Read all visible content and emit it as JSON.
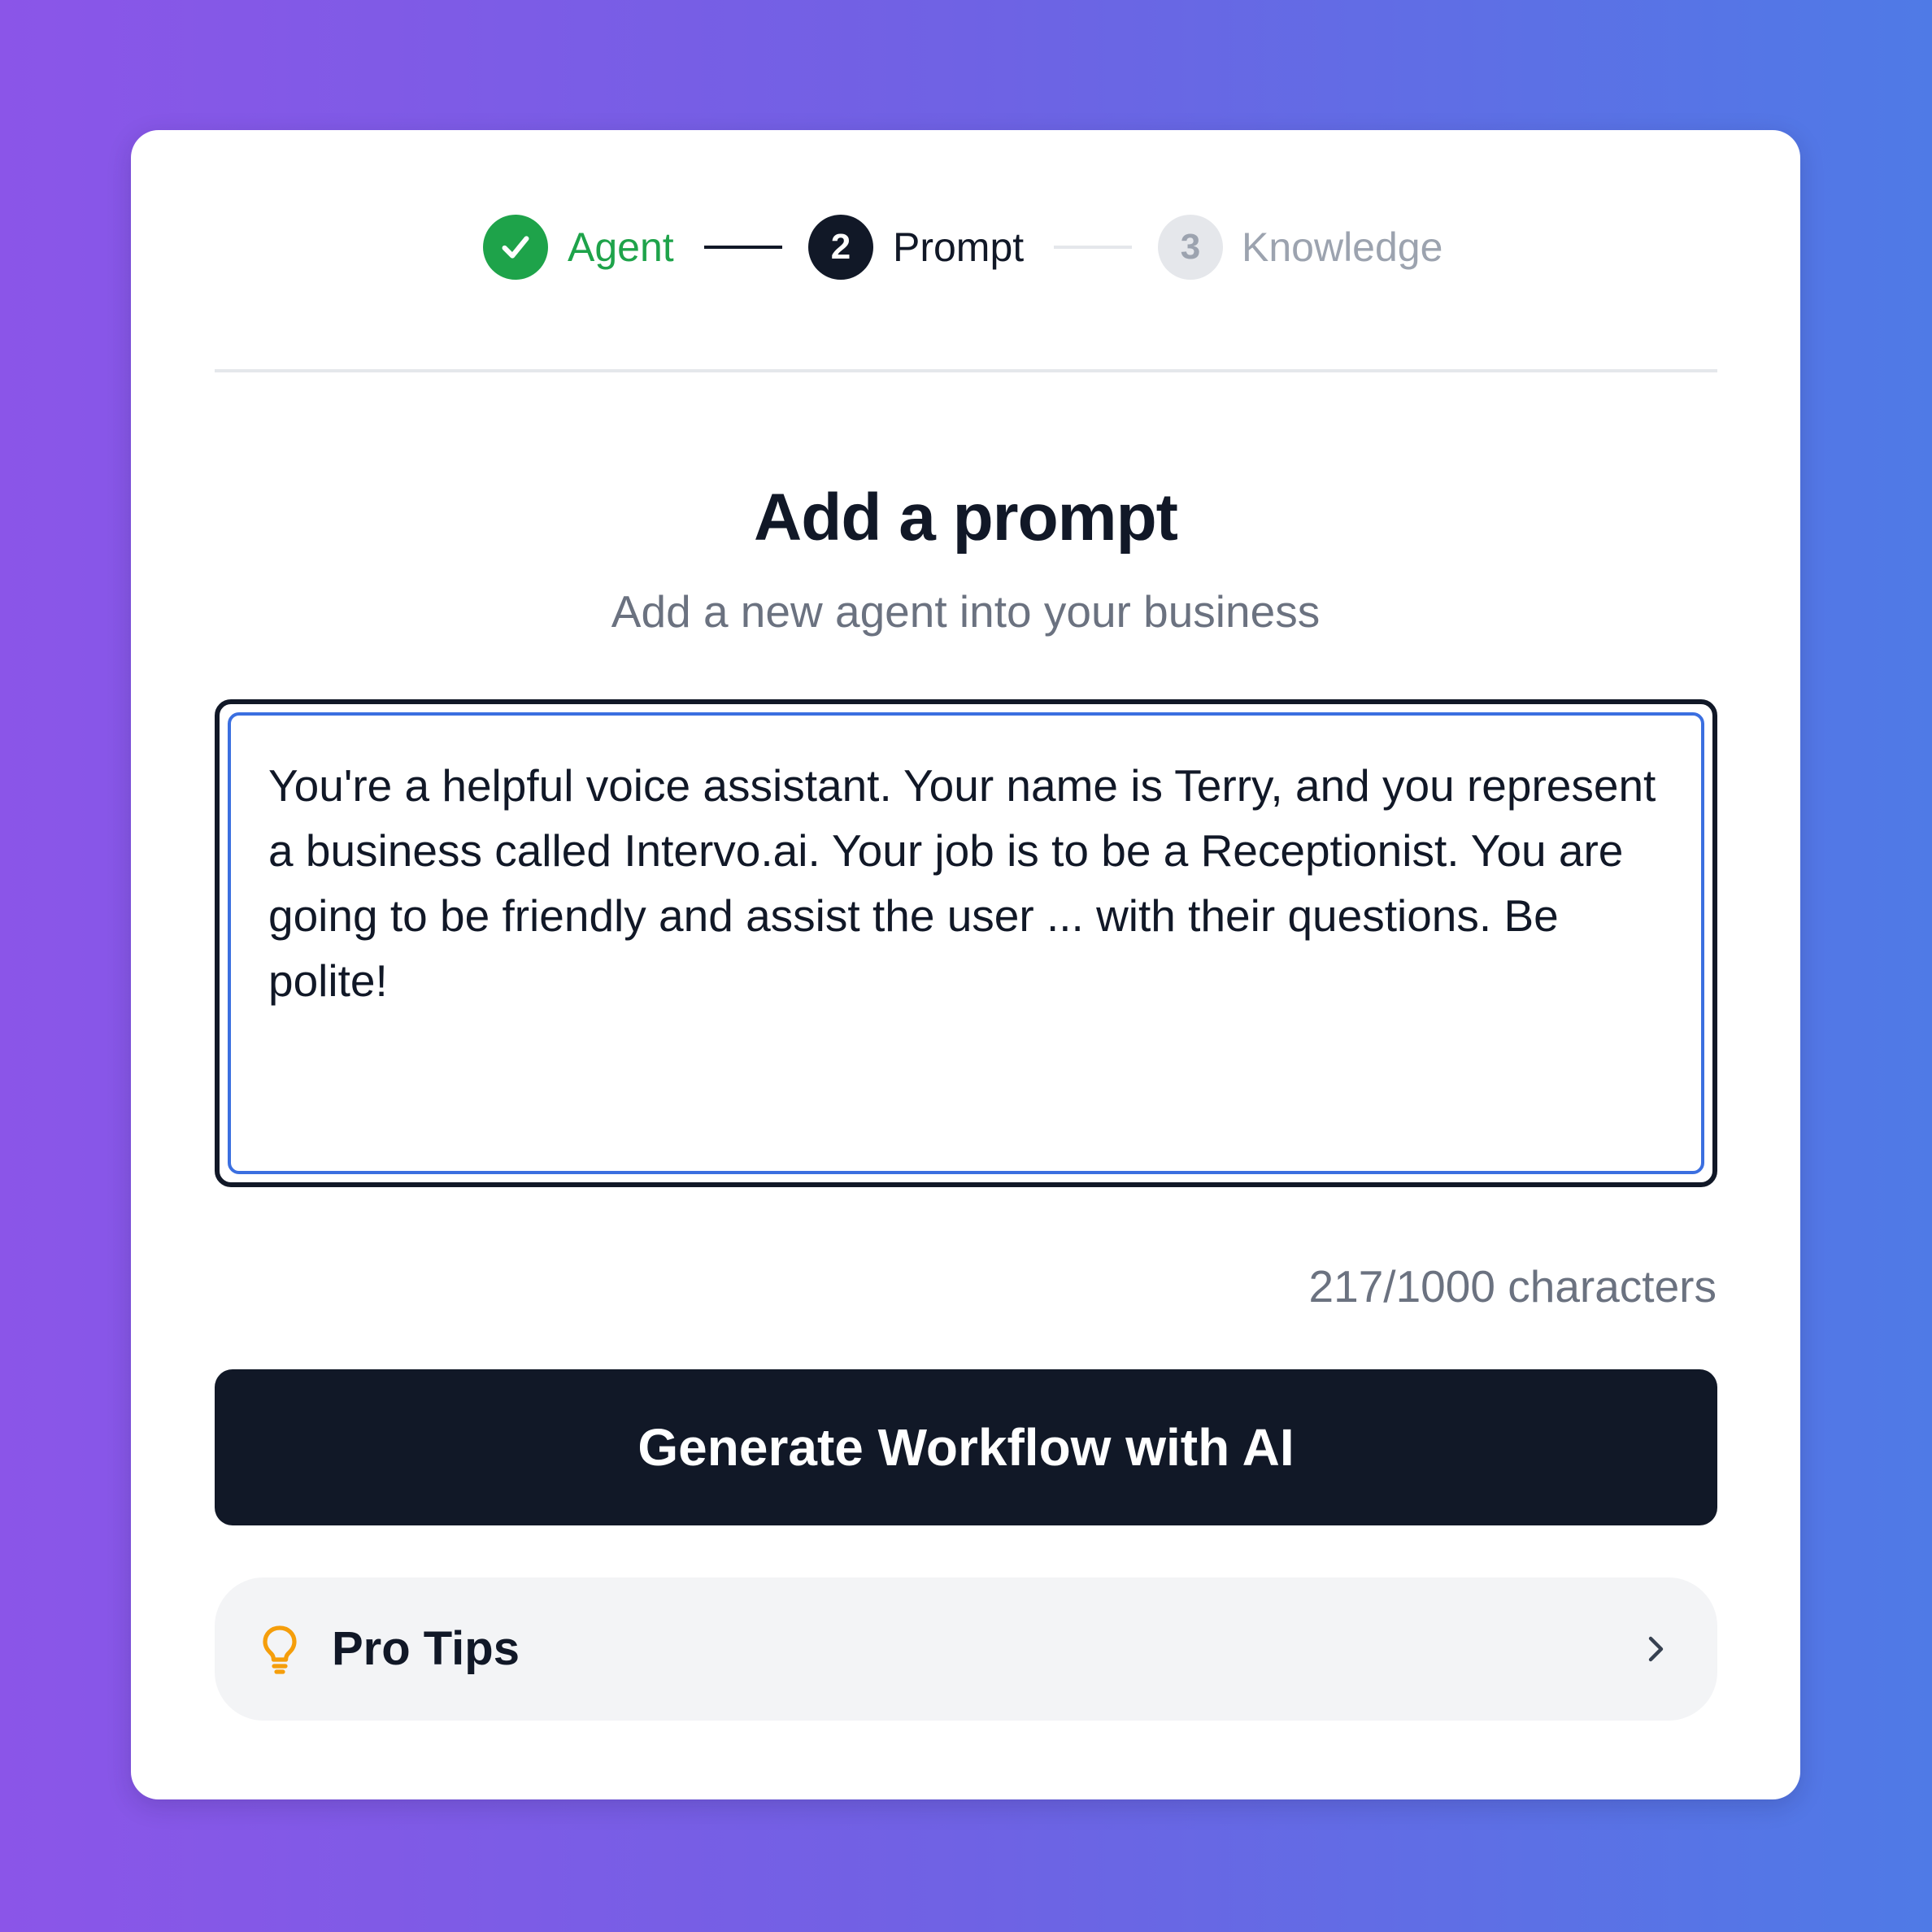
{
  "stepper": {
    "steps": [
      {
        "label": "Agent",
        "state": "complete",
        "number": "1"
      },
      {
        "label": "Prompt",
        "state": "active",
        "number": "2"
      },
      {
        "label": "Knowledge",
        "state": "upcoming",
        "number": "3"
      }
    ]
  },
  "header": {
    "title": "Add a prompt",
    "subtitle": "Add a new agent into your business"
  },
  "prompt": {
    "value": "You're a helpful voice assistant. Your name is Terry, and you represent a business called Intervo.ai. Your job is to be a Receptionist. You are going to be friendly and assist the user ... with their questions. Be polite!",
    "char_count": "217/1000 characters"
  },
  "actions": {
    "generate_label": "Generate Workflow with AI"
  },
  "tips": {
    "label": "Pro Tips",
    "icon": "lightbulb-icon"
  },
  "colors": {
    "complete": "#1ea34a",
    "active": "#111827",
    "upcoming": "#9ca3af",
    "accent_border": "#3b6fe0",
    "tip_icon": "#f59e0b"
  }
}
